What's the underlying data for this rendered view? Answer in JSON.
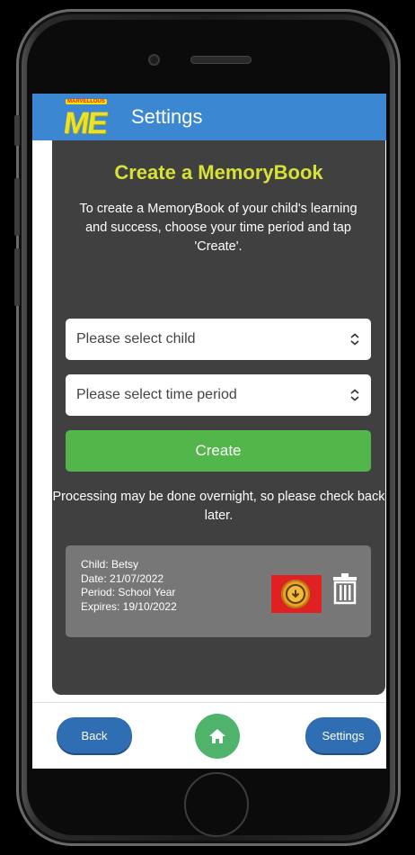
{
  "header": {
    "logo_small_text": "MARVELLOUS",
    "logo_text": "ME",
    "title": "Settings"
  },
  "main": {
    "title": "Create a MemoryBook",
    "intro": "To create a MemoryBook of your child's learning and success, choose your time period and tap 'Create'.",
    "child_select_placeholder": "Please select child",
    "period_select_placeholder": "Please select time period",
    "create_label": "Create",
    "note": "Processing may be done overnight, so please check back later."
  },
  "memory_card": {
    "child": "Child: Betsy",
    "date": "Date: 21/07/2022",
    "period": "Period: School Year",
    "expires": "Expires: 19/10/2022",
    "download_icon": "download-icon",
    "delete_icon": "trash-icon"
  },
  "bottom_nav": {
    "back_label": "Back",
    "home_icon": "home-icon",
    "settings_label": "Settings"
  },
  "colors": {
    "header": "#3c87d1",
    "panel": "#404040",
    "title": "#d8e135",
    "create": "#52b64b",
    "highlight": "#e02121",
    "nav_button": "#2f6eb3",
    "home_button": "#4fb36b"
  }
}
